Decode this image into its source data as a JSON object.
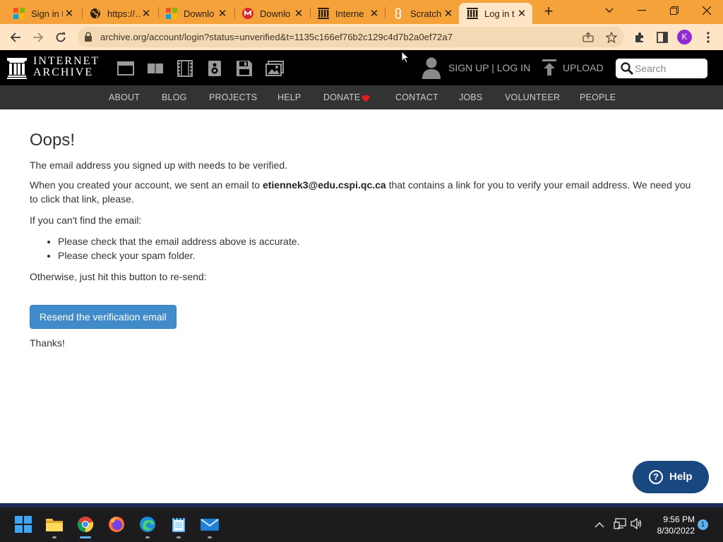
{
  "browser": {
    "tabs": [
      {
        "label": "Sign in to",
        "icon": "microsoft-icon"
      },
      {
        "label": "https://…",
        "icon": "globe-icon"
      },
      {
        "label": "Downlo",
        "icon": "microsoft-icon"
      },
      {
        "label": "Downlo",
        "icon": "mega-icon"
      },
      {
        "label": "Interne",
        "icon": "internet-archive-icon"
      },
      {
        "label": "Scratch",
        "icon": "scratch-icon"
      },
      {
        "label": "Log in t",
        "icon": "internet-archive-icon"
      }
    ],
    "url": "archive.org/account/login?status=unverified&t=1135c166ef76b2c129c4d7b2a0ef72a7",
    "profile_initial": "K",
    "colors": {
      "tabstrip": "#f5a23a",
      "toolbar": "#fde5c6",
      "profile": "#8f2bd1"
    }
  },
  "ia_header": {
    "logo_line1": "INTERNET",
    "logo_line2": "ARCHIVE",
    "signup_login": "SIGN UP | LOG IN",
    "upload": "UPLOAD",
    "search_placeholder": "Search",
    "nav": [
      "ABOUT",
      "BLOG",
      "PROJECTS",
      "HELP",
      "DONATE",
      "CONTACT",
      "JOBS",
      "VOLUNTEER",
      "PEOPLE"
    ],
    "donate_heart_color": "#e31b23"
  },
  "main": {
    "heading": "Oops!",
    "p1": "The email address you signed up with needs to be verified.",
    "p2_before": "When you created your account, we sent an email to ",
    "email": "etiennek3@edu.cspi.qc.ca",
    "p2_after": " that contains a link for you to verify your email address. We need you to click that link, please.",
    "p3": "If you can't find the email:",
    "bullets": [
      "Please check that the email address above is accurate.",
      "Please check your spam folder."
    ],
    "p4": "Otherwise, just hit this button to re-send:",
    "resend_button": "Resend the verification email",
    "thanks": "Thanks!",
    "button_color": "#428bca"
  },
  "help_widget": {
    "label": "Help",
    "color": "#194880"
  },
  "taskbar": {
    "apps": [
      "windows-start-icon",
      "file-explorer-icon",
      "chrome-icon",
      "firefox-icon",
      "edge-icon",
      "notepad-icon",
      "mail-icon"
    ],
    "time": "9:56 PM",
    "date": "8/30/2022",
    "notification_count": "1"
  }
}
